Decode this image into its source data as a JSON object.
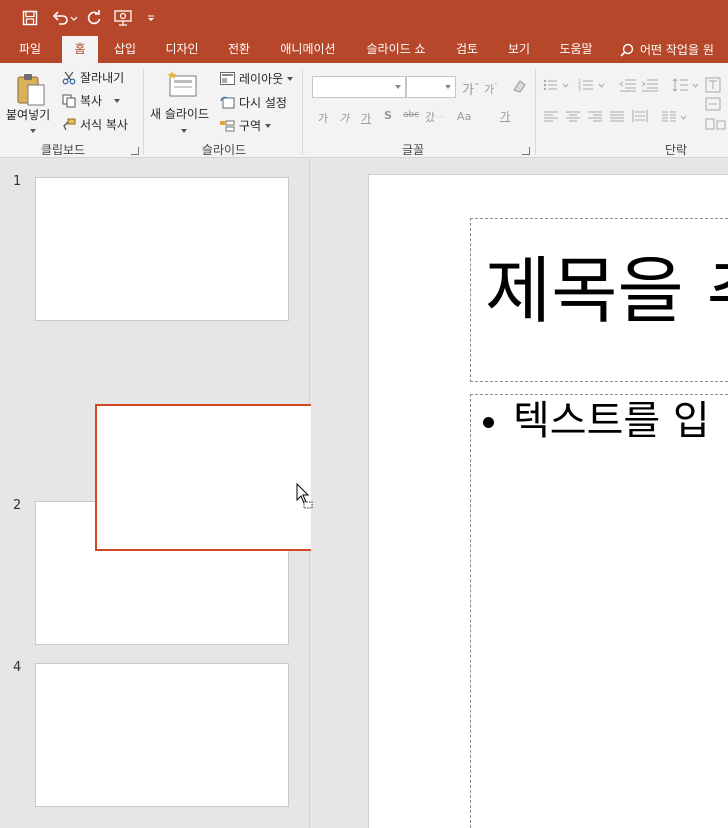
{
  "quick_access": {
    "save_icon": "save-icon",
    "undo_icon": "undo-icon",
    "redo_icon": "redo-icon",
    "present_icon": "present-from-beginning-icon",
    "customize_icon": "customize-qat-icon"
  },
  "tabs": [
    {
      "label": "파일"
    },
    {
      "label": "홈",
      "active": true
    },
    {
      "label": "삽입"
    },
    {
      "label": "디자인"
    },
    {
      "label": "전환"
    },
    {
      "label": "애니메이션"
    },
    {
      "label": "슬라이드 쇼"
    },
    {
      "label": "검토"
    },
    {
      "label": "보기"
    },
    {
      "label": "도움말"
    }
  ],
  "tell_me": {
    "placeholder": "어떤 작업을 원하시나요?",
    "visible_text": "어떤 작업을 원"
  },
  "ribbon": {
    "clipboard": {
      "paste": "붙여넣기",
      "cut": "잘라내기",
      "copy": "복사",
      "format_painter": "서식 복사",
      "group_label": "클립보드"
    },
    "slides": {
      "new_slide_line1": "새 슬라이드",
      "layout": "레이아웃",
      "reset": "다시 설정",
      "section": "구역",
      "group_label": "슬라이드"
    },
    "font": {
      "font_name_value": "",
      "font_size_value": "",
      "group_label": "글꼴",
      "bold": "가",
      "italic": "가",
      "underline": "가",
      "shadow": "S",
      "strike": "abc",
      "spacing": "갔ᆢ",
      "case": "Aa",
      "color": "가"
    },
    "paragraph": {
      "group_label": "단락"
    }
  },
  "thumbnails": [
    {
      "number": "1"
    },
    {
      "number": "2"
    },
    {
      "number": "4"
    }
  ],
  "slide": {
    "title_placeholder": "제목을 추",
    "body_placeholder": "텍스트를 입"
  },
  "colors": {
    "accent": "#b7472a",
    "drag_border": "#d24726"
  }
}
